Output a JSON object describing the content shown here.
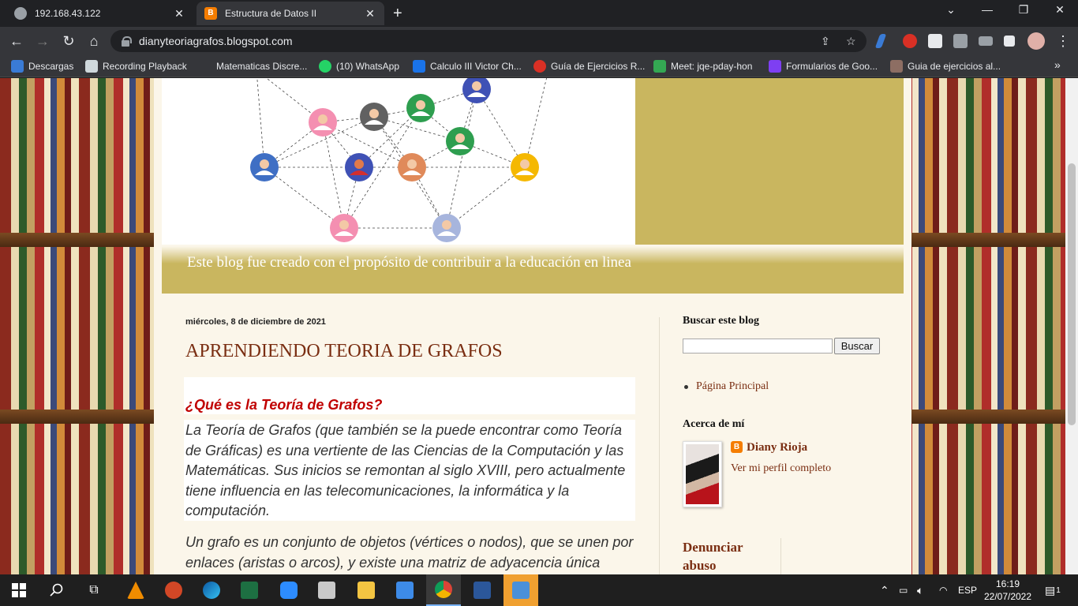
{
  "browser": {
    "tabs": [
      {
        "title": "192.168.43.122",
        "active": false
      },
      {
        "title": "Estructura de Datos II",
        "active": true
      }
    ],
    "url": "dianyteoriagrafos.blogspot.com",
    "bookmarks": [
      {
        "label": "Descargas"
      },
      {
        "label": "Recording Playback"
      },
      {
        "label": "Matematicas Discre..."
      },
      {
        "label": "(10) WhatsApp"
      },
      {
        "label": "Calculo III Victor Ch..."
      },
      {
        "label": "Guía de Ejercicios R..."
      },
      {
        "label": "Meet: jqe-pday-hon"
      },
      {
        "label": "Formularios de Goo..."
      },
      {
        "label": "Guia de ejercicios al..."
      }
    ],
    "bookmarks_overflow": "»"
  },
  "blog": {
    "description": "Este blog fue creado con el propósito de contribuir a la educación en linea",
    "post": {
      "date": "miércoles, 8 de diciembre de 2021",
      "title": "APRENDIENDO TEORIA DE GRAFOS",
      "question": "¿Qué es la Teoría de Grafos?",
      "paragraph1": "La Teoría de Grafos (que también se la puede encontrar como Teoría de Gráficas) es una vertiente de las Ciencias de la Computación y las Matemáticas. Sus inicios se remontan al siglo XVIII, pero actualmente tiene influencia en las telecomunicaciones, la informática y la computación.",
      "paragraph2": "Un grafo es un conjunto de objetos (vértices o nodos), que se unen por enlaces (aristas o arcos), y  existe una matriz de adyacencia única"
    },
    "sidebar": {
      "search_heading": "Buscar este blog",
      "search_button": "Buscar",
      "pages_link": "Página Principal",
      "about_heading": "Acerca de mí",
      "profile_name": "Diany Rioja",
      "profile_link": "Ver mi perfil completo",
      "report_heading": "Denunciar abuso"
    }
  },
  "taskbar": {
    "language": "ESP",
    "time": "16:19",
    "date": "22/07/2022",
    "notifications": "1"
  },
  "colors": {
    "accent_gold": "#c9b65f",
    "title_brown": "#7a2e12",
    "question_red": "#c00000"
  }
}
